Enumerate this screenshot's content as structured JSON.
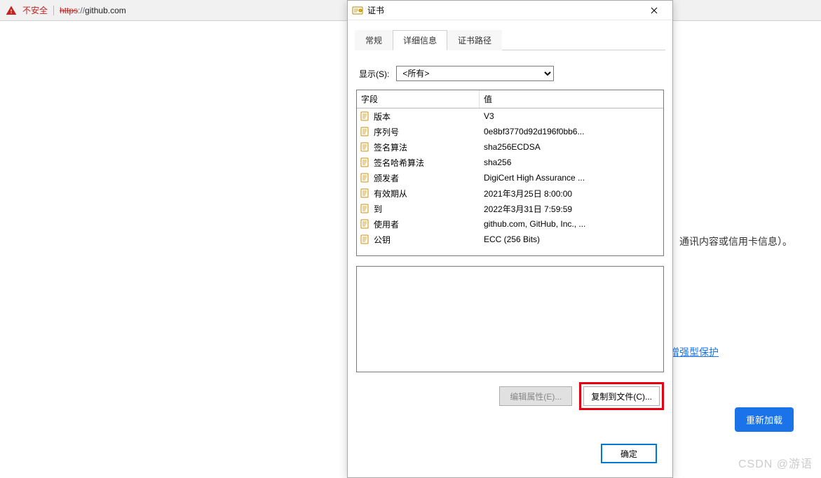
{
  "address_bar": {
    "warning_text": "不安全",
    "url_protocol": "https",
    "url_sep": "://",
    "url_host": "github.com"
  },
  "background": {
    "partial_text": "、通讯内容或信用卡信息）。",
    "enhanced_protection": "增强型保护",
    "reload_button": "重新加载",
    "watermark": "CSDN @游语"
  },
  "dialog": {
    "title": "证书",
    "tabs": {
      "general": "常规",
      "details": "详细信息",
      "path": "证书路径"
    },
    "show_label": "显示(S):",
    "show_options": [
      "<所有>"
    ],
    "headers": {
      "field": "字段",
      "value": "值"
    },
    "fields": [
      {
        "field": "版本",
        "value": "V3"
      },
      {
        "field": "序列号",
        "value": "0e8bf3770d92d196f0bb6..."
      },
      {
        "field": "签名算法",
        "value": "sha256ECDSA"
      },
      {
        "field": "签名哈希算法",
        "value": "sha256"
      },
      {
        "field": "颁发者",
        "value": "DigiCert High Assurance ..."
      },
      {
        "field": "有效期从",
        "value": "2021年3月25日 8:00:00"
      },
      {
        "field": "到",
        "value": "2022年3月31日 7:59:59"
      },
      {
        "field": "使用者",
        "value": "github.com, GitHub, Inc., ..."
      },
      {
        "field": "公钥",
        "value": "ECC (256 Bits)"
      }
    ],
    "buttons": {
      "edit_props": "编辑属性(E)...",
      "copy_to_file": "复制到文件(C)...",
      "ok": "确定"
    }
  }
}
